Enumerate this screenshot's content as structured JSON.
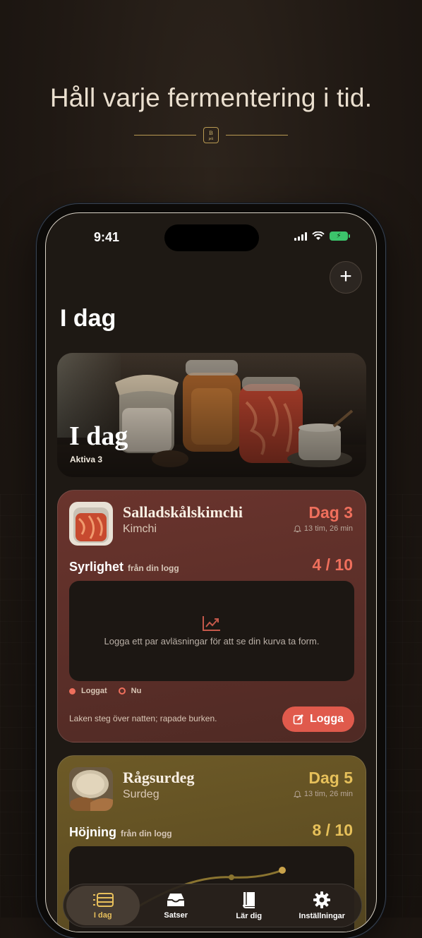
{
  "headline": "Håll varje fermentering i tid.",
  "brand_badge": {
    "letter": "B",
    "sub": "jeli"
  },
  "status_bar": {
    "time": "9:41"
  },
  "page": {
    "title": "I dag"
  },
  "hero": {
    "title": "I dag",
    "subtitle": "Aktiva  3"
  },
  "cards": [
    {
      "name": "Salladskålskimchi",
      "type": "Kimchi",
      "day": "Dag 3",
      "timer": "13 tim, 26 min",
      "metric_label": "Syrlighet",
      "metric_sub": "från din logg",
      "metric_value": "4 / 10",
      "chart_message": "Logga ett par avläsningar för att se din kurva ta form.",
      "legend_logged": "Loggat",
      "legend_now": "Nu",
      "note": "Laken steg över natten; rapade burken.",
      "log_button": "Logga",
      "accent": "#ef6f5c"
    },
    {
      "name": "Rågsurdeg",
      "type": "Surdeg",
      "day": "Dag 5",
      "timer": "13 tim, 26 min",
      "metric_label": "Höjning",
      "metric_sub": "från din logg",
      "metric_value": "8 / 10",
      "accent": "#e6c05a"
    }
  ],
  "tabs": [
    {
      "label": "I dag",
      "icon": "today-icon",
      "active": true
    },
    {
      "label": "Satser",
      "icon": "tray-icon",
      "active": false
    },
    {
      "label": "Lär dig",
      "icon": "book-icon",
      "active": false
    },
    {
      "label": "Inställningar",
      "icon": "gear-icon",
      "active": false
    }
  ]
}
